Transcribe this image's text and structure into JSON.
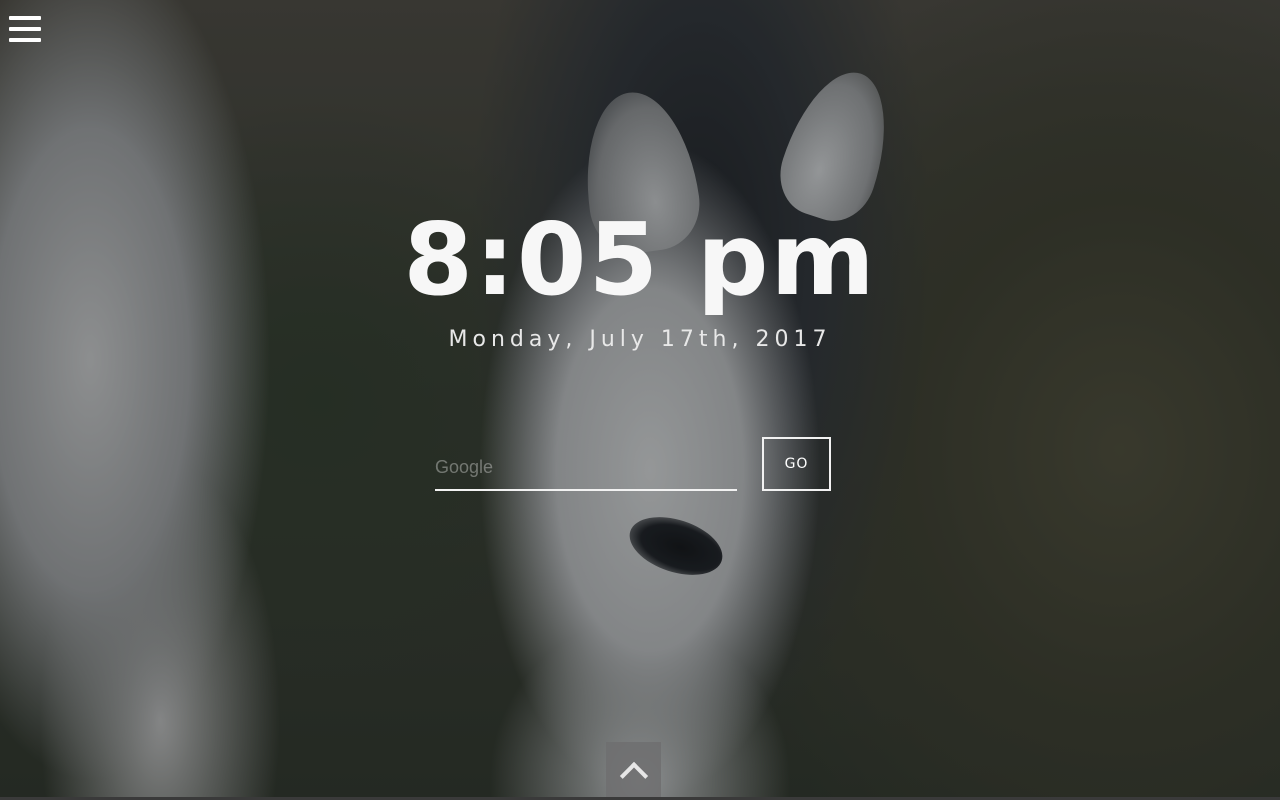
{
  "header": {
    "menu_icon": "hamburger-menu-icon"
  },
  "clock": {
    "time": "8:05 pm",
    "date": "Monday, July 17th, 2017"
  },
  "search": {
    "placeholder": "Google",
    "value": "",
    "go_label": "GO"
  },
  "footer": {
    "scroll_icon": "chevron-up-icon"
  },
  "colors": {
    "text": "#ffffff",
    "scroll_button_bg": "#6e6e70"
  }
}
